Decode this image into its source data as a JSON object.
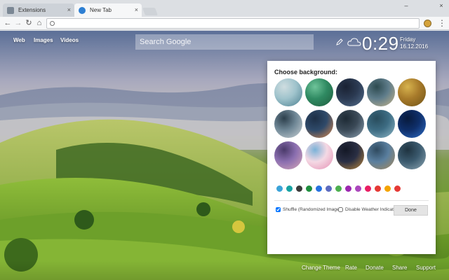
{
  "browser": {
    "tabs": [
      {
        "title": "Extensions",
        "close": "×"
      },
      {
        "title": "New Tab",
        "close": "×"
      }
    ],
    "window_controls": {
      "minimize": "–",
      "close": "×"
    },
    "nav": {
      "back": "←",
      "forward": "→",
      "reload": "↻",
      "home": "⌂"
    },
    "menu": "⋮"
  },
  "page": {
    "top_links": [
      "Web",
      "Images",
      "Videos"
    ],
    "search_placeholder": "Search Google",
    "clock": "0:29",
    "day": "Friday",
    "date": "16.12.2016",
    "footer_links": [
      "Change Theme",
      "Rate",
      "Donate",
      "Share",
      "Support"
    ]
  },
  "panel": {
    "title": "Choose background:",
    "thumbnails": [
      {
        "name": "waterfall",
        "colors": [
          "#9fc3cc",
          "#4a7f8f",
          "#cfdde0"
        ]
      },
      {
        "name": "green-lagoon",
        "colors": [
          "#2f8a62",
          "#1f5b3c",
          "#6fc49a"
        ]
      },
      {
        "name": "night-harbor",
        "colors": [
          "#2b3a52",
          "#55708f",
          "#1a2233"
        ]
      },
      {
        "name": "mountain-lake",
        "colors": [
          "#5f7d8b",
          "#c7b58a",
          "#2d4a4f"
        ]
      },
      {
        "name": "autumn-forest",
        "colors": [
          "#a77a2a",
          "#6e5216",
          "#d7b34e"
        ]
      },
      {
        "name": "alpine-peak",
        "colors": [
          "#6f8796",
          "#c9d1d5",
          "#2c3f4c"
        ]
      },
      {
        "name": "sunset-sea",
        "colors": [
          "#2f4a6a",
          "#e08a4a",
          "#1d2f46"
        ]
      },
      {
        "name": "dark-waves",
        "colors": [
          "#3b4a58",
          "#8ea3b3",
          "#1d2a34"
        ]
      },
      {
        "name": "bay-boats",
        "colors": [
          "#3d6c83",
          "#8fb8c8",
          "#284c5c"
        ]
      },
      {
        "name": "night-tower",
        "colors": [
          "#0f2f6a",
          "#2e6ec8",
          "#081a3c"
        ]
      },
      {
        "name": "purple-dusk",
        "colors": [
          "#8b6fb0",
          "#d7a7b7",
          "#4a3a6a"
        ]
      },
      {
        "name": "cherry-blossom",
        "colors": [
          "#f4d9e4",
          "#e58fb3",
          "#7ab2d8"
        ]
      },
      {
        "name": "city-lights",
        "colors": [
          "#2a2f44",
          "#c08a3a",
          "#141826"
        ]
      },
      {
        "name": "canyon-lake",
        "colors": [
          "#5a7f9f",
          "#a88a5a",
          "#2f4a5f"
        ]
      },
      {
        "name": "blue-forest",
        "colors": [
          "#3b5a6e",
          "#8ea7b4",
          "#1f3340"
        ]
      }
    ],
    "swatches": [
      "#3ba3d8",
      "#17a2a2",
      "#3a3a3a",
      "#1e8e3e",
      "#2672e0",
      "#5c6bc0",
      "#4caf50",
      "#9c27b0",
      "#ab47bc",
      "#e91e63",
      "#e53935",
      "#f4a300",
      "#e53935"
    ],
    "shuffle_label": "Shuffle (Randomized Images)",
    "shuffle_checked": true,
    "weather_label": "Disable Weather Indicator",
    "weather_checked": false,
    "done_label": "Done"
  }
}
